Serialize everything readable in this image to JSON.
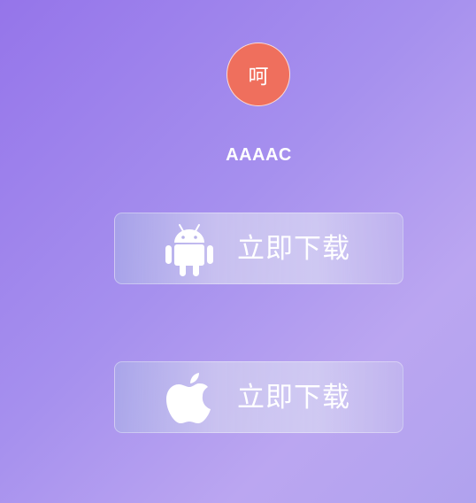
{
  "avatar": {
    "text": "呵",
    "color": "#ef6f5d"
  },
  "app": {
    "name": "AAAAC"
  },
  "downloads": {
    "android": {
      "icon": "android-icon",
      "label": "立即下载"
    },
    "ios": {
      "icon": "apple-icon",
      "label": "立即下载"
    }
  },
  "colors": {
    "background_start": "#9575ea",
    "background_end": "#bba6f1",
    "text": "#ffffff"
  }
}
